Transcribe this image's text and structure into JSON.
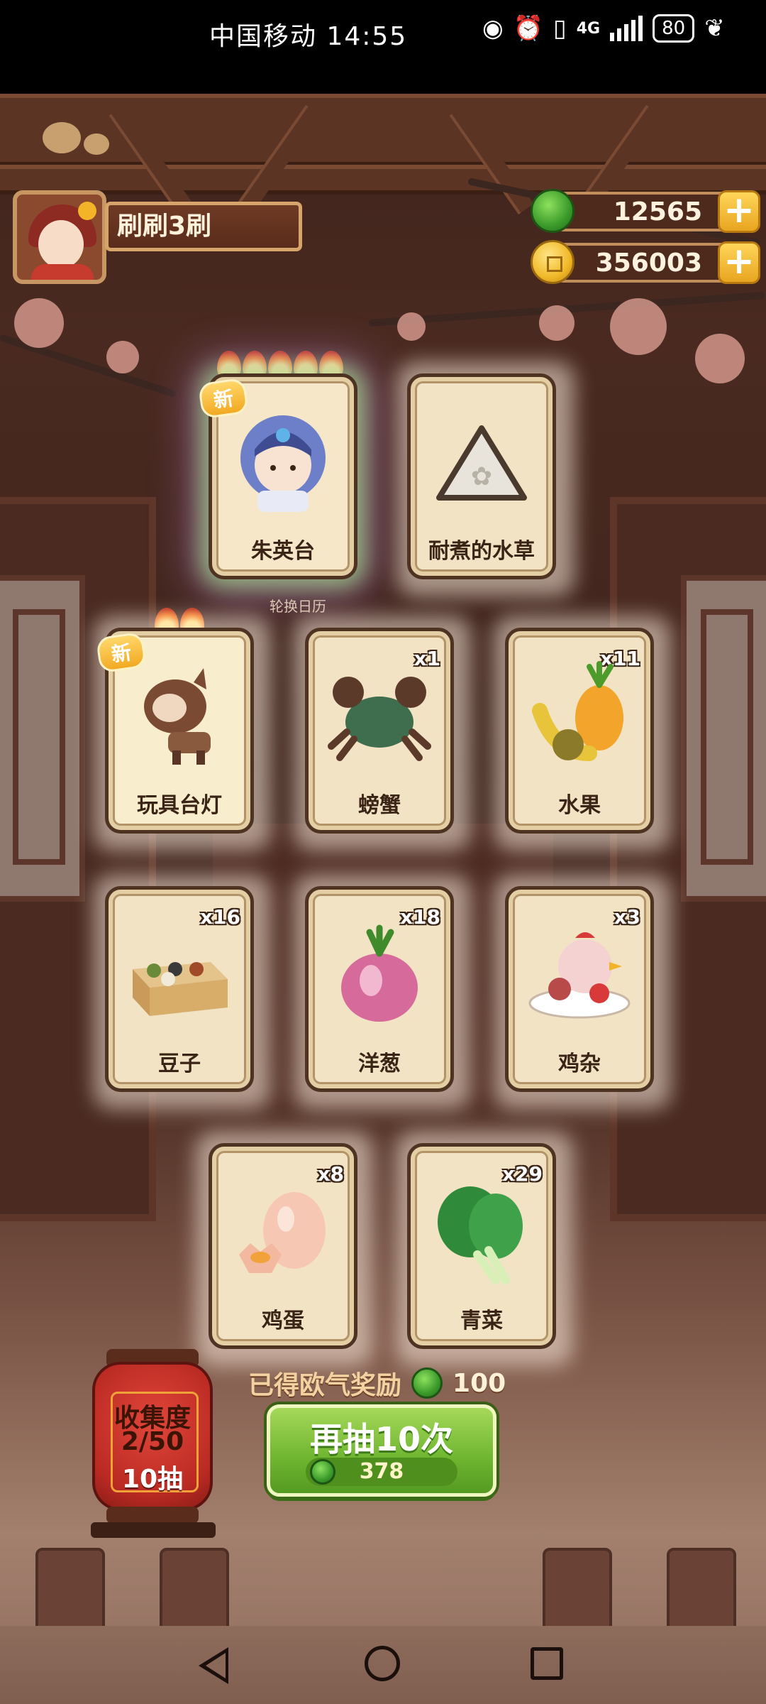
{
  "status_bar": {
    "carrier": "中国移动",
    "time": "14:55",
    "network": "4G",
    "battery": "80",
    "icons": [
      "eye-icon",
      "alarm-icon",
      "vibrate-icon",
      "signal-icon",
      "battery-icon",
      "leaf-icon"
    ]
  },
  "player": {
    "name": "刷刷3刷"
  },
  "currencies": {
    "jade": "12565",
    "gold": "356003"
  },
  "cards": {
    "c1": {
      "name": "朱英台",
      "is_new": true,
      "new_label": "新",
      "flames": 5
    },
    "c2": {
      "name": "耐煮的水草"
    },
    "c3": {
      "name": "玩具台灯",
      "is_new": true,
      "new_label": "新",
      "flames": 2
    },
    "c4": {
      "name": "螃蟹",
      "count": "x1"
    },
    "c5": {
      "name": "水果",
      "count": "x11"
    },
    "c6": {
      "name": "豆子",
      "count": "x16"
    },
    "c7": {
      "name": "洋葱",
      "count": "x18"
    },
    "c8": {
      "name": "鸡杂",
      "count": "x3"
    },
    "c9": {
      "name": "鸡蛋",
      "count": "x8"
    },
    "c10": {
      "name": "青菜",
      "count": "x29"
    }
  },
  "sub_label": "轮换日历",
  "reward": {
    "label": "已得欧气奖励",
    "value": "100"
  },
  "draw_button": {
    "label": "再抽10次",
    "cost": "378"
  },
  "collection": {
    "title": "收集度",
    "progress": "2/50",
    "draws": "10抽"
  },
  "colors": {
    "accent_green": "#6eb530",
    "card_bg": "#f2e3c4",
    "lantern_red": "#b92a22"
  }
}
